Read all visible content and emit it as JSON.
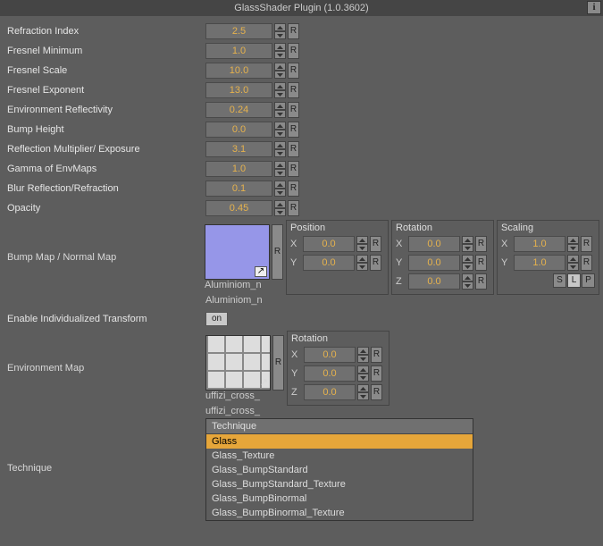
{
  "title": "GlassShader Plugin (1.0.3602)",
  "params": [
    {
      "label": "Refraction Index",
      "value": "2.5"
    },
    {
      "label": "Fresnel Minimum",
      "value": "1.0"
    },
    {
      "label": "Fresnel Scale",
      "value": "10.0"
    },
    {
      "label": "Fresnel Exponent",
      "value": "13.0"
    },
    {
      "label": "Environment Reflectivity",
      "value": "0.24"
    },
    {
      "label": "Bump Height",
      "value": "0.0"
    },
    {
      "label": "Reflection Multiplier/ Exposure",
      "value": "3.1"
    },
    {
      "label": "Gamma of EnvMaps",
      "value": "1.0"
    },
    {
      "label": "Blur Reflection/Refraction",
      "value": "0.1"
    },
    {
      "label": "Opacity",
      "value": "0.45"
    }
  ],
  "bumpMap": {
    "label": "Bump Map / Normal Map",
    "thumbCaption": "Aluminiom_n",
    "fullName": "Aluminiom_n",
    "position": {
      "title": "Position",
      "X": "0.0",
      "Y": "0.0"
    },
    "rotation": {
      "title": "Rotation",
      "X": "0.0",
      "Y": "0.0",
      "Z": "0.0"
    },
    "scaling": {
      "title": "Scaling",
      "X": "1.0",
      "Y": "1.0",
      "slp": [
        "S",
        "L",
        "P"
      ]
    }
  },
  "enableTransform": {
    "label": "Enable Individualized Transform",
    "value": "on"
  },
  "envMap": {
    "label": "Environment Map",
    "thumbCaption": "uffizi_cross_",
    "fullName": "uffizi_cross_",
    "rotation": {
      "title": "Rotation",
      "X": "0.0",
      "Y": "0.0",
      "Z": "0.0"
    }
  },
  "technique": {
    "label": "Technique",
    "header": "Technique",
    "items": [
      "Glass",
      "Glass_Texture",
      "Glass_BumpStandard",
      "Glass_BumpStandard_Texture",
      "Glass_BumpBinormal",
      "Glass_BumpBinormal_Texture"
    ],
    "selectedIndex": 0
  },
  "reset": "R",
  "cornerGlyph": "↗"
}
